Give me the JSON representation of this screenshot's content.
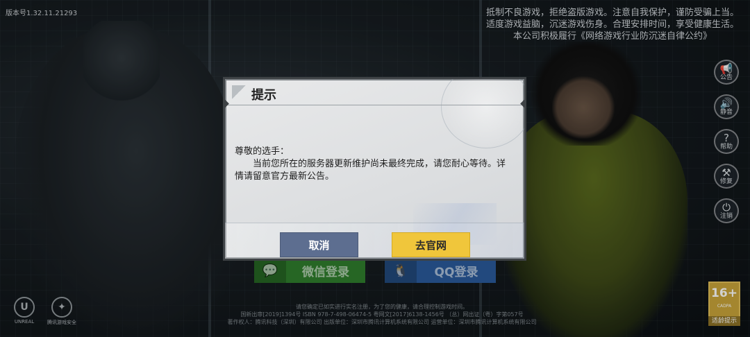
{
  "version": "版本号1.32.11.21293",
  "health_notice": {
    "line1": "抵制不良游戏，拒绝盗版游戏。注意自我保护，谨防受骗上当。",
    "line2": "适度游戏益脑，沉迷游戏伤身。合理安排时间，享受健康生活。",
    "line3": "本公司积极履行《网络游戏行业防沉迷自律公约》"
  },
  "side_tools": {
    "notice": {
      "label": "公告",
      "icon": "megaphone-icon"
    },
    "mute": {
      "label": "静音",
      "icon": "speaker-icon"
    },
    "help": {
      "label": "帮助",
      "icon": "question-icon"
    },
    "repair": {
      "label": "修复",
      "icon": "wrench-icon"
    },
    "logout": {
      "label": "注销",
      "icon": "power-icon"
    }
  },
  "login": {
    "wechat_label": "微信登录",
    "qq_label": "QQ登录"
  },
  "logos": {
    "unreal": "UNREAL",
    "other": "腾讯游戏安全"
  },
  "legal": {
    "line1": "请您确定已如实进行实名注册，为了您的健康，请合理控制游戏时间。",
    "line2": "国新出审[2019]1394号  ISBN 978-7-498-06474-5  粤网文[2017]6138-1456号 （总）网出证（粤）字第057号",
    "line3": "著作权人：腾讯科技（深圳）有限公司    出版单位：深圳市腾讯计算机系统有限公司    运营单位：深圳市腾讯计算机系统有限公司"
  },
  "age_badge": {
    "rating": "16+",
    "sub": "CADPA",
    "caption": "适龄提示"
  },
  "dialog": {
    "title": "提示",
    "greeting": "尊敬的选手：",
    "message": "当前您所在的服务器更新维护尚未最终完成，请您耐心等待。详情请留意官方最新公告。",
    "cancel_label": "取消",
    "confirm_label": "去官网"
  },
  "colors": {
    "cancel_button": "#5d6e90",
    "confirm_button": "#f0c63b",
    "wechat": "#2f7d2c",
    "qq": "#2a5a9a",
    "age_badge": "#c9a43a"
  }
}
